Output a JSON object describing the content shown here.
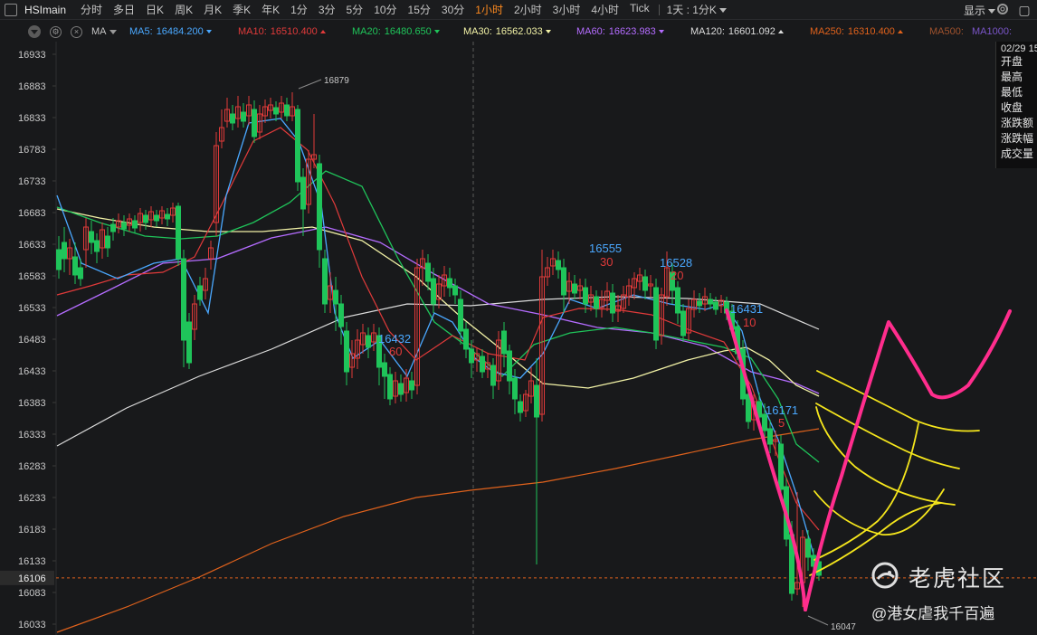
{
  "toolbar": {
    "symbol": "HSImain",
    "periods": [
      "分时",
      "多日",
      "日K",
      "周K",
      "月K",
      "季K",
      "年K",
      "1分",
      "3分",
      "5分",
      "10分",
      "15分",
      "30分",
      "1小时",
      "2小时",
      "3小时",
      "4小时",
      "Tick"
    ],
    "active_period": "1小时",
    "range_select": "1天 : 1分K",
    "display_label": "显示",
    "active_color": "#ff8a1e",
    "icons": [
      "window-icon",
      "gear-icon",
      "more-icon"
    ]
  },
  "ma_bar": {
    "type_label": "MA",
    "items": [
      {
        "name": "MA5:",
        "value": "16484.200",
        "color": "#4aa8ff",
        "trend": "down"
      },
      {
        "name": "MA10:",
        "value": "16510.400",
        "color": "#e03a3a",
        "trend": "up"
      },
      {
        "name": "MA20:",
        "value": "16480.650",
        "color": "#1fc45a",
        "trend": "down"
      },
      {
        "name": "MA30:",
        "value": "16562.033",
        "color": "#f2f2a6",
        "trend": "down"
      },
      {
        "name": "MA60:",
        "value": "16623.983",
        "color": "#b46cff",
        "trend": "down"
      },
      {
        "name": "MA120:",
        "value": "16601.092",
        "color": "#dcdcdc",
        "trend": "up"
      },
      {
        "name": "MA250:",
        "value": "16310.400",
        "color": "#e0621c",
        "trend": "up"
      },
      {
        "name": "MA500:",
        "value": "",
        "color": "#a0522d",
        "trend": ""
      },
      {
        "name": "MA1000:",
        "value": "",
        "color": "#7a55c8",
        "trend": ""
      }
    ]
  },
  "info_panel": {
    "date": "02/29 15",
    "labels": [
      "开盘",
      "最高",
      "最低",
      "收盘",
      "涨跌额",
      "涨跌幅",
      "成交量"
    ]
  },
  "price_axis": {
    "ticks": [
      "16933",
      "16883",
      "16833",
      "16783",
      "16733",
      "16683",
      "16633",
      "16583",
      "16533",
      "16483",
      "16433",
      "16383",
      "16333",
      "16283",
      "16233",
      "16183",
      "16133",
      "16083",
      "16033"
    ],
    "current_price": "16106"
  },
  "annotations": [
    {
      "text": "16879",
      "kind": "high-label"
    },
    {
      "text": "16047",
      "kind": "low-label"
    },
    {
      "text": "16432",
      "kind": "td-count",
      "color": "#4aa8ff"
    },
    {
      "text": "60",
      "kind": "td-count",
      "color": "#e03a3a"
    },
    {
      "text": "16555",
      "kind": "td-count",
      "color": "#4aa8ff"
    },
    {
      "text": "30",
      "kind": "td-count",
      "color": "#e03a3a"
    },
    {
      "text": "16528",
      "kind": "td-count",
      "color": "#4aa8ff"
    },
    {
      "text": "20",
      "kind": "td-count",
      "color": "#e03a3a"
    },
    {
      "text": "16431",
      "kind": "td-count",
      "color": "#4aa8ff"
    },
    {
      "text": "10",
      "kind": "td-count",
      "color": "#e03a3a"
    },
    {
      "text": "16171",
      "kind": "td-count",
      "color": "#4aa8ff"
    },
    {
      "text": "5",
      "kind": "td-count",
      "color": "#e03a3a"
    }
  ],
  "colors": {
    "up_candle": "#e03a3a",
    "down_candle": "#1fc45a",
    "drawing_pink": "#ff2d8d",
    "drawing_yellow": "#f5e61c",
    "background": "#18191b"
  },
  "watermark": {
    "title": "老虎社区",
    "user": "@港女虐我千百遍"
  }
}
